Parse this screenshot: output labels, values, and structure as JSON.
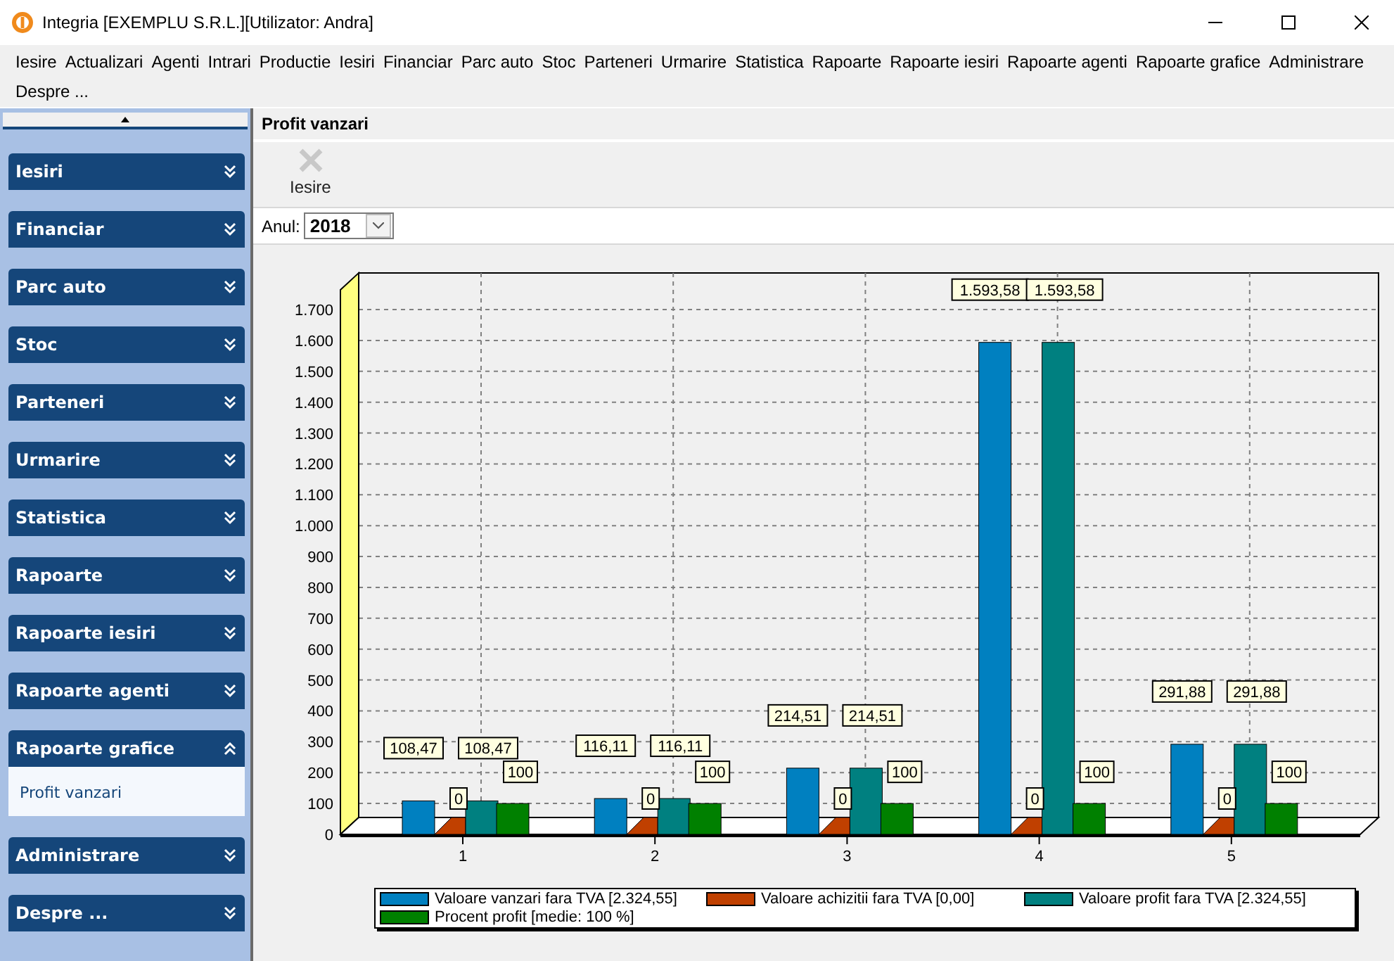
{
  "window": {
    "title": "Integria [EXEMPLU S.R.L.][Utilizator: Andra]"
  },
  "menu": [
    "Iesire",
    "Actualizari",
    "Agenti",
    "Intrari",
    "Productie",
    "Iesiri",
    "Financiar",
    "Parc auto",
    "Stoc",
    "Parteneri",
    "Urmarire",
    "Statistica",
    "Rapoarte",
    "Rapoarte iesiri",
    "Rapoarte agenti",
    "Rapoarte grafice",
    "Administrare",
    "Despre ..."
  ],
  "sidebar": {
    "groups": [
      {
        "label": "Iesiri",
        "expanded": false
      },
      {
        "label": "Financiar",
        "expanded": false
      },
      {
        "label": "Parc auto",
        "expanded": false
      },
      {
        "label": "Stoc",
        "expanded": false
      },
      {
        "label": "Parteneri",
        "expanded": false
      },
      {
        "label": "Urmarire",
        "expanded": false
      },
      {
        "label": "Statistica",
        "expanded": false
      },
      {
        "label": "Rapoarte",
        "expanded": false
      },
      {
        "label": "Rapoarte iesiri",
        "expanded": false
      },
      {
        "label": "Rapoarte agenti",
        "expanded": false
      },
      {
        "label": "Rapoarte grafice",
        "expanded": true,
        "items": [
          "Profit vanzari"
        ]
      },
      {
        "label": "Administrare",
        "expanded": false
      },
      {
        "label": "Despre ...",
        "expanded": false
      }
    ]
  },
  "panel": {
    "title": "Profit vanzari",
    "toolbar": [
      {
        "label": "Iesire",
        "disabled": true
      }
    ],
    "year_label": "Anul:",
    "year": "2018"
  },
  "chart": {
    "chart_data": {
      "type": "bar",
      "categories": [
        "1",
        "2",
        "3",
        "4",
        "5"
      ],
      "ylim": [
        0,
        1700
      ],
      "yticks": [
        0,
        100,
        200,
        300,
        400,
        500,
        600,
        700,
        800,
        900,
        {
          "value": 1000,
          "label": "1.000"
        },
        {
          "value": 1100,
          "label": "1.100"
        },
        {
          "value": 1200,
          "label": "1.200"
        },
        {
          "value": 1300,
          "label": "1.300"
        },
        {
          "value": 1400,
          "label": "1.400"
        },
        {
          "value": 1500,
          "label": "1.500"
        },
        {
          "value": 1600,
          "label": "1.600"
        },
        {
          "value": 1700,
          "label": "1.700"
        }
      ],
      "data_labels": true,
      "grid": true,
      "legend": "bottom",
      "series": [
        {
          "name": "Valoare vanzari fara TVA [2.324,55]",
          "color": "#0080c0",
          "values": [
            108.47,
            116.11,
            214.51,
            1593.58,
            291.88
          ],
          "value_labels": [
            "108,47",
            "116,11",
            "214,51",
            "1.593,58",
            "291,88"
          ]
        },
        {
          "name": "Valoare achizitii fara TVA [0,00]",
          "color": "#c04000",
          "values": [
            0,
            0,
            0,
            0,
            0
          ],
          "value_labels": [
            "0",
            "0",
            "0",
            "0",
            "0"
          ]
        },
        {
          "name": "Valoare profit fara TVA [2.324,55]",
          "color": "#008080",
          "values": [
            108.47,
            116.11,
            214.51,
            1593.58,
            291.88
          ],
          "value_labels": [
            "108,47",
            "116,11",
            "214,51",
            "1.593,58",
            "291,88"
          ]
        },
        {
          "name": "Procent profit [medie: 100 %]",
          "color": "#008000",
          "values": [
            100,
            100,
            100,
            100,
            100
          ],
          "value_labels": [
            "100",
            "100",
            "100",
            "100",
            "100"
          ]
        }
      ]
    }
  }
}
